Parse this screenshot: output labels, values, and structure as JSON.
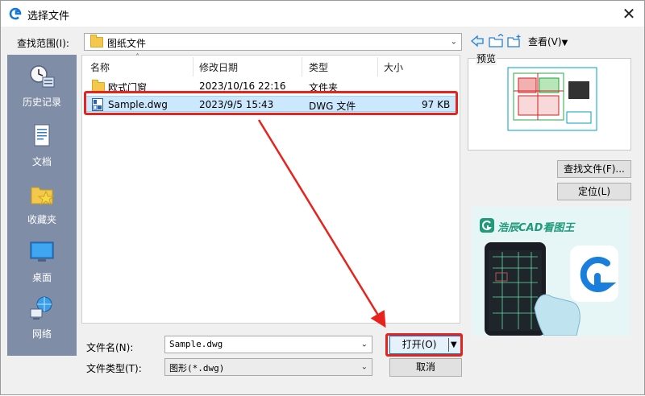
{
  "window": {
    "title": "选择文件",
    "close_label": "✕"
  },
  "toolbar": {
    "lookin_label": "查找范围(I):",
    "lookin_value": "图纸文件",
    "view_label": "查看(V)",
    "icons": [
      "back-arrow-icon",
      "up-folder-icon",
      "new-folder-icon"
    ]
  },
  "sidebar": {
    "items": [
      {
        "label": "历史记录",
        "icon": "history-icon"
      },
      {
        "label": "文档",
        "icon": "document-icon"
      },
      {
        "label": "收藏夹",
        "icon": "favorites-icon"
      },
      {
        "label": "桌面",
        "icon": "desktop-icon"
      },
      {
        "label": "网络",
        "icon": "network-icon"
      }
    ]
  },
  "filelist": {
    "columns": [
      "名称",
      "修改日期",
      "类型",
      "大小"
    ],
    "rows": [
      {
        "name": "欧式门窗",
        "date": "2023/10/16 22:16",
        "type": "文件夹",
        "size": "",
        "icon": "folder-icon"
      },
      {
        "name": "Sample.dwg",
        "date": "2023/9/5 15:43",
        "type": "DWG 文件",
        "size": "97 KB",
        "icon": "dwg-file-icon",
        "selected": true
      }
    ]
  },
  "preview": {
    "label": "预览"
  },
  "buttons": {
    "find_file": "查找文件(F)...",
    "locate": "定位(L)",
    "open": "打开(O)",
    "cancel": "取消"
  },
  "form": {
    "filename_label": "文件名(N):",
    "filename_value": "Sample.dwg",
    "filetype_label": "文件类型(T):",
    "filetype_value": "图形(*.dwg)"
  },
  "ad": {
    "brand": "浩辰CAD看图王"
  },
  "colors": {
    "sidebar": "#7f8ea6",
    "highlight": "#e8231d",
    "selection": "#cce8ff"
  }
}
